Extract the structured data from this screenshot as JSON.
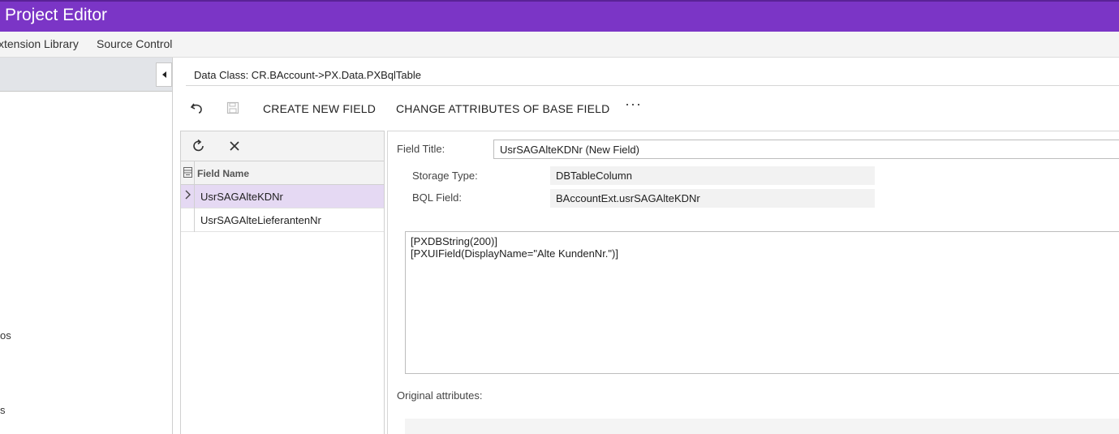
{
  "app": {
    "title": "Project Editor"
  },
  "menubar": {
    "items": [
      "xtension Library",
      "Source Control"
    ]
  },
  "sidebar": {
    "fragments": [
      "os",
      "s"
    ]
  },
  "data_class": {
    "label": "Data Class:",
    "value": "CR.BAccount->PX.Data.PXBqlTable",
    "full": "Data Class: CR.BAccount->PX.Data.PXBqlTable"
  },
  "toolbar": {
    "create_label": "CREATE NEW FIELD",
    "change_label": "CHANGE ATTRIBUTES OF BASE FIELD",
    "more_label": "···",
    "icons": [
      "undo-icon",
      "save-icon",
      "more-icon"
    ]
  },
  "grid": {
    "toolbar_icons": [
      "refresh-icon",
      "close-icon"
    ],
    "header": "Field Name",
    "rows": [
      {
        "name": "UsrSAGAlteKDNr",
        "selected": true
      },
      {
        "name": "UsrSAGAlteLieferantenNr",
        "selected": false
      }
    ]
  },
  "form": {
    "field_title_label": "Field Title:",
    "field_title_value": "UsrSAGAlteKDNr (New Field)",
    "storage_type_label": "Storage Type:",
    "storage_type_value": "DBTableColumn",
    "bql_field_label": "BQL Field:",
    "bql_field_value": "BAccountExt.usrSAGAlteKDNr",
    "code_lines": [
      "[PXDBString(200)]",
      "[PXUIField(DisplayName=\"Alte KundenNr.\")]"
    ],
    "original_attributes_label": "Original attributes:"
  },
  "colors": {
    "accent": "#7b35c6",
    "selected_row": "#e5d9f3"
  }
}
